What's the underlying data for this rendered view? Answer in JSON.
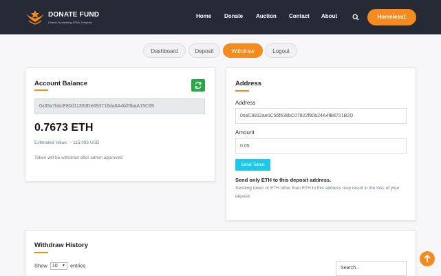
{
  "brand": {
    "title": "DONATE FUND",
    "subtitle": "Charity Fundraising HTML Template",
    "accent": "#f58a1f"
  },
  "nav": {
    "items": [
      "Home",
      "Donate",
      "Auction",
      "Contact",
      "About"
    ],
    "search_icon": "search-icon",
    "user_label": "Homeless1"
  },
  "tabs": [
    {
      "label": "Dashboard",
      "active": false
    },
    {
      "label": "Deposit",
      "active": false
    },
    {
      "label": "Withdraw",
      "active": true
    },
    {
      "label": "Logout",
      "active": false
    }
  ],
  "balance_card": {
    "title": "Account Balance",
    "refresh_icon": "refresh-icon",
    "wallet_address": "0x35a7bbcE80d11350De693716da6A4b25baA15C99",
    "balance": "0.7673 ETH",
    "estimated": "Estimated Value: ~ 115.095 USD",
    "note": "Token will be withdraw after admin approved"
  },
  "address_card": {
    "title": "Address",
    "address_label": "Address",
    "address_value": "0xaC8832ae0C56f638bC07822f90b24A4fBd721B2D",
    "amount_label": "Amount",
    "amount_value": "0.05",
    "send_label": "Send Token",
    "warn_title": "Send only ETH to this deposit address.",
    "warn_text": "Sending token or ETH other than ETH to this address may result in the loss of your deposit."
  },
  "history": {
    "title": "Withdraw History",
    "show_label": "Show",
    "show_value": "10",
    "entries_label": "entries",
    "search_placeholder": "Search..."
  },
  "colors": {
    "header_bg": "#262a36",
    "refresh_green": "#28a745",
    "send_cyan": "#1ec8e8"
  }
}
